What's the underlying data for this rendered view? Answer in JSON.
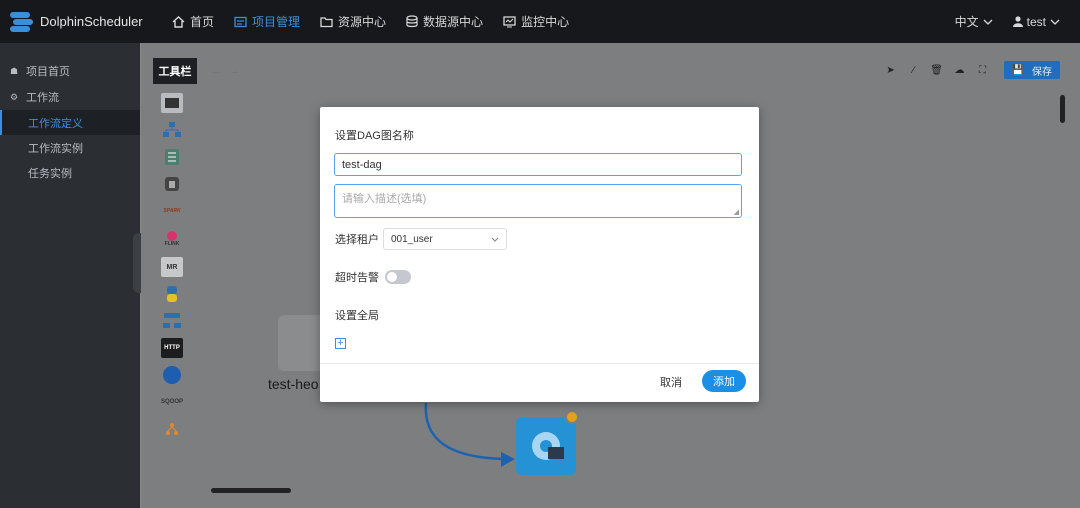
{
  "app": {
    "name": "DolphinScheduler"
  },
  "nav": {
    "items": [
      {
        "label": "首页",
        "icon": "home-icon"
      },
      {
        "label": "项目管理",
        "icon": "project-icon",
        "active": true
      },
      {
        "label": "资源中心",
        "icon": "folder-icon"
      },
      {
        "label": "数据源中心",
        "icon": "database-icon"
      },
      {
        "label": "监控中心",
        "icon": "monitor-icon"
      }
    ],
    "language": "中文",
    "user": "test"
  },
  "sidebar": {
    "items": [
      {
        "label": "项目首页",
        "icon": "home-icon"
      },
      {
        "label": "工作流",
        "icon": "gear-icon"
      }
    ],
    "sub_items": [
      {
        "label": "工作流定义",
        "active": true
      },
      {
        "label": "工作流实例"
      },
      {
        "label": "任务实例"
      }
    ]
  },
  "canvas": {
    "toolbar_label": "工具栏",
    "save_label": "保存",
    "tools": [
      "SHELL",
      "SUB_PROCESS",
      "PROCEDURE",
      "SQL",
      "SPARK",
      "FLINK",
      "MR",
      "PYTHON",
      "DEPENDENT",
      "HTTP",
      "DATAX",
      "SQOOP",
      "CONDITIONS"
    ],
    "node_label": "test-heo"
  },
  "dialog": {
    "title": "设置DAG图名称",
    "name_value": "test-dag",
    "desc_placeholder": "请输入描述(选填)",
    "tenant_label": "选择租户",
    "tenant_value": "001_user",
    "alarm_label": "超时告警",
    "alarm_on": false,
    "global_label": "设置全局",
    "cancel_label": "取消",
    "add_label": "添加"
  },
  "colors": {
    "accent": "#1b8ee6",
    "nav_bg": "#16181b",
    "sidebar_bg": "#2b2e33"
  }
}
